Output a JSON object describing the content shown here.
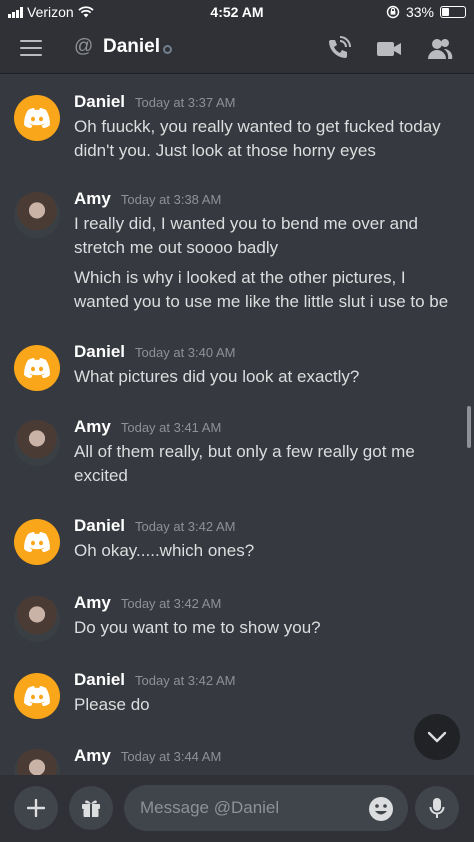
{
  "status_bar": {
    "carrier": "Verizon",
    "time": "4:52 AM",
    "battery": "33%",
    "battery_level": 0.33
  },
  "header": {
    "at_symbol": "@",
    "title": "Daniel"
  },
  "messages": [
    {
      "author": "Daniel",
      "timestamp": "Today at 3:37 AM",
      "avatar": "discord-logo-icon",
      "lines": [
        "Oh fuuckk, you really wanted to get fucked today",
        "didn't you. Just look at those horny eyes"
      ]
    },
    {
      "author": "Amy",
      "timestamp": "Today at 3:38 AM",
      "avatar": "user-photo",
      "lines": [
        "I really did, I wanted you to bend me over and",
        "stretch me out soooo badly",
        "Which is why i looked at the other pictures, I",
        "wanted you to use me like the little slut i use to be"
      ]
    },
    {
      "author": "Daniel",
      "timestamp": "Today at 3:40 AM",
      "avatar": "discord-logo-icon",
      "lines": [
        "What pictures did you look at exactly?"
      ]
    },
    {
      "author": "Amy",
      "timestamp": "Today at 3:41 AM",
      "avatar": "user-photo",
      "lines": [
        "All of them really, but only a few really got me",
        "excited"
      ]
    },
    {
      "author": "Daniel",
      "timestamp": "Today at 3:42 AM",
      "avatar": "discord-logo-icon",
      "lines": [
        "Oh okay.....which ones?"
      ]
    },
    {
      "author": "Amy",
      "timestamp": "Today at 3:42 AM",
      "avatar": "user-photo",
      "lines": [
        "Do you want to me to show you?"
      ]
    },
    {
      "author": "Daniel",
      "timestamp": "Today at 3:42 AM",
      "avatar": "discord-logo-icon",
      "lines": [
        "Please do"
      ]
    },
    {
      "author": "Amy",
      "timestamp": "Today at 3:44 AM",
      "avatar": "user-photo",
      "lines": []
    }
  ],
  "composer": {
    "placeholder": "Message @Daniel"
  },
  "colors": {
    "background": "#36393f",
    "header": "#2f3136",
    "discord_avatar": "#faa61a",
    "input": "#40444b"
  }
}
